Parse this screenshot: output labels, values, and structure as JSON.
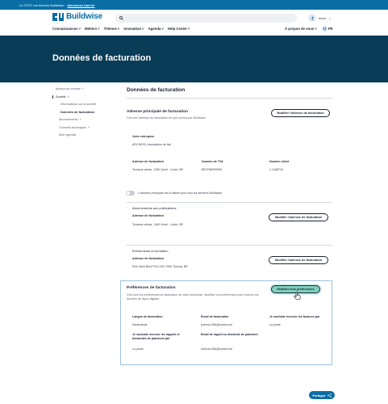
{
  "topbar": {
    "text": "Le CSTC est devenu Buildwise :",
    "link": "découvrez tout ici"
  },
  "header": {
    "logo_text": "Buildwise",
    "user_name": "Ixxxx"
  },
  "nav": {
    "items": [
      "Connaissances",
      "Métiers",
      "Thèmes",
      "Innovation",
      "Agenda",
      "Help Center"
    ],
    "about": "À propos de vous",
    "lang": "FR"
  },
  "hero": {
    "title": "Données de facturation"
  },
  "sidebar": {
    "items": [
      "Aperçu du compte",
      "Société",
      "Informations sur la société",
      "Données de facturation",
      "Abonnements",
      "Conseils techniques",
      "Mon agenda"
    ]
  },
  "main": {
    "title": "Données de facturation",
    "primary": {
      "title": "Adresse principale de facturation",
      "desc": "Ceci est l'adresse de facturation tel que connus par Buildwise",
      "button": "Modifier l'adresse de facturation",
      "company_label": "Votre entreprise",
      "company_value": "ARCHIPEL Association de fait",
      "address_label": "Adresse de facturation",
      "address_value": "Terrasse aimes, 1180 Uccel - Uccle, BE",
      "vat_label": "Numéro de TVA",
      "vat_value": "BE0766090998",
      "client_label": "Numéro client",
      "client_value": "1-1168716"
    },
    "toggle_label": "L'adresse principale est à utiliser pour tous les services Buildwise",
    "subscriptions": {
      "title": "Abonnements aux publications",
      "address_label": "Adresse de facturation",
      "address_value": "Terrasse aimes, 1180 Uccel - Uccle, BE",
      "button": "Modifier l'adresse de facturation"
    },
    "events": {
      "title": "Événements et formation",
      "address_label": "Adresse de facturation",
      "address_value": "Rue Saint BriceTOU-18C,7500 Tournai, BE",
      "button": "Modifier l'adresse de facturation"
    },
    "preferences": {
      "title": "Préférences de facturation",
      "desc": "Ceci sont les préférences de facturation de votre entreprise. Modifiez vos préférences pour recevoir les factures de façon digitale.",
      "button": "Modifier mes préférences",
      "lang_label": "Langue de facturation",
      "lang_value": "Nederlands",
      "email_label": "Email de facturation",
      "email_value": "jortxxxx-654@ymail.com",
      "receive_label": "Je souhaite recevoir les factures par",
      "receive_value": "La poste",
      "reminder_label": "Je souhaite recevoir les rappels et demandes de paiement par",
      "reminder_value": "La poste",
      "reminder_email_label": "Email de rappel ou demande de paiement",
      "reminder_email_value": "iortxxxx-654@ymail.com"
    }
  },
  "share": {
    "label": "Partager"
  },
  "search": {
    "placeholder": ""
  }
}
